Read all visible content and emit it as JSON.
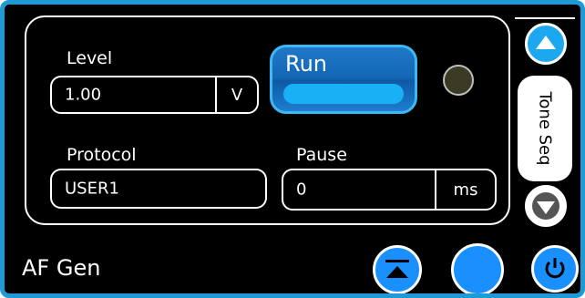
{
  "panel": {
    "level": {
      "label": "Level",
      "value": "1.00",
      "unit": "V"
    },
    "protocol": {
      "label": "Protocol",
      "value": "USER1"
    },
    "pause": {
      "label": "Pause",
      "value": "0",
      "unit": "ms"
    },
    "run_label": "Run",
    "indicator": {
      "icon": "status-led-icon",
      "color": "#3a3a25"
    }
  },
  "side": {
    "tab_label": "Tone Seq",
    "up_icon": "chevron-up-icon",
    "down_icon": "chevron-down-icon"
  },
  "footer": {
    "title": "AF Gen",
    "buttons": [
      {
        "icon": "scroll-top-icon"
      },
      {
        "icon": "circle-button-icon"
      },
      {
        "icon": "power-icon"
      }
    ]
  },
  "colors": {
    "accent": "#1a90ff",
    "frame": "#1e9ad6",
    "run": "#1467b5"
  }
}
